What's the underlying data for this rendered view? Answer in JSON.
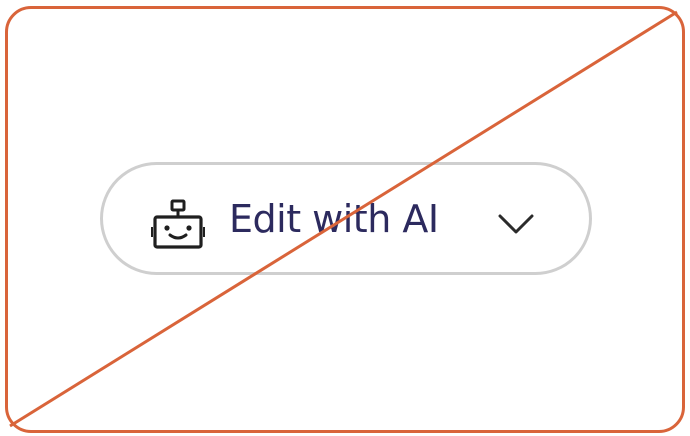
{
  "button": {
    "label": "Edit with AI",
    "icon": "robot-icon",
    "dropdown_icon": "chevron-down-icon",
    "text_color": "#2c2a5e",
    "border_color": "#cfcfcf"
  },
  "frame": {
    "border_color": "#d9643a"
  }
}
